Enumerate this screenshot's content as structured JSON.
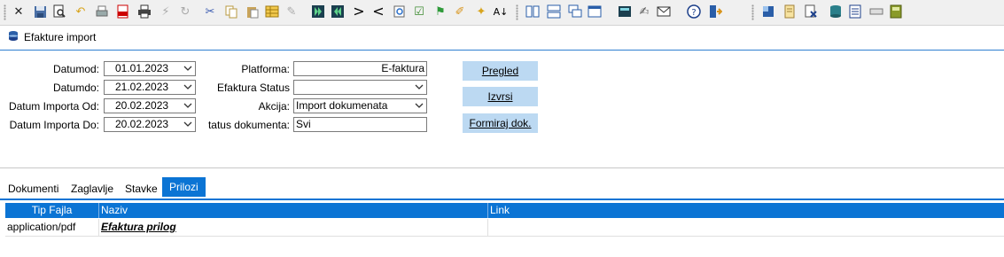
{
  "window": {
    "title": "Efakture import"
  },
  "toolbar": {
    "icons": [
      "close-icon",
      "save-icon",
      "print-preview-icon",
      "undo-icon",
      "print-icon",
      "pdf-icon",
      "printer-icon",
      "refresh-icon",
      "cut-icon",
      "copy-icon",
      "paste-icon",
      "grid-icon",
      "eraser-icon",
      "first-record-icon",
      "last-record-icon",
      "greater-than-icon",
      "less-than-icon",
      "search-icon",
      "check-icon",
      "flag-icon",
      "pen-icon",
      "magic-icon",
      "sort-icon",
      "layout-1-icon",
      "layout-2-icon",
      "layout-3-icon",
      "layout-4-icon",
      "calculator-icon",
      "edit-icon",
      "mail-icon",
      "help-icon",
      "exit-icon",
      "tools-icon",
      "notes-icon",
      "delete-doc-icon",
      "database-icon",
      "report-icon",
      "key-icon",
      "book-icon"
    ]
  },
  "filters": {
    "datumod_label": "Datumod:",
    "datumod_value": "01.01.2023",
    "datumdo_label": "Datumdo:",
    "datumdo_value": "21.02.2023",
    "import_od_label": "Datum Importa Od:",
    "import_od_value": "20.02.2023",
    "import_do_label": "Datum Importa Do:",
    "import_do_value": "20.02.2023",
    "platforma_label": "Platforma:",
    "platforma_value": "E-faktura",
    "efaktura_status_label": "Efaktura Status",
    "efaktura_status_value": "",
    "akcija_label": "Akcija:",
    "akcija_value": "Import dokumenata",
    "status_dok_label": "tatus dokumenta:",
    "status_dok_value": "Svi"
  },
  "buttons": {
    "pregled": "Pregled",
    "izvrsi": "Izvrsi",
    "formiraj": "Formiraj dok."
  },
  "tabs": [
    {
      "label": "Dokumenti"
    },
    {
      "label": "Zaglavlje"
    },
    {
      "label": "Stavke"
    },
    {
      "label": "Prilozi",
      "active": true
    }
  ],
  "grid": {
    "columns": [
      "Tip Fajla",
      "Naziv",
      "Link"
    ],
    "rows": [
      {
        "tip": "application/pdf",
        "naziv": "Efaktura prilog",
        "link": ""
      }
    ]
  },
  "colors": {
    "accent": "#0b74d4",
    "button": "#bcd9f2",
    "toolbar": "#f0f0f0"
  }
}
